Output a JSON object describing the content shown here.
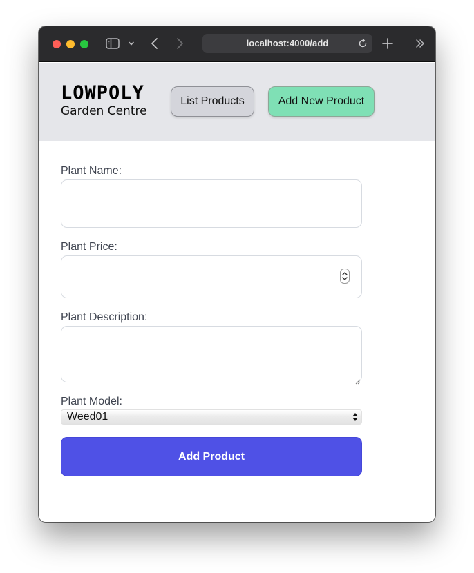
{
  "browser": {
    "url": "localhost:4000/add"
  },
  "header": {
    "logo_main": "LOWPOLY",
    "logo_sub": "Garden Centre",
    "nav": {
      "list_label": "List Products",
      "add_label": "Add New Product"
    },
    "colors": {
      "header_bg": "#e5e6ea",
      "list_button_bg": "#d4d5db",
      "add_button_bg": "#7fe0b5"
    }
  },
  "form": {
    "name_label": "Plant Name:",
    "name_value": "",
    "price_label": "Plant Price:",
    "price_value": "",
    "description_label": "Plant Description:",
    "description_value": "",
    "model_label": "Plant Model:",
    "model_selected": "Weed01",
    "submit_label": "Add Product",
    "colors": {
      "submit_bg": "#4f51e6"
    }
  }
}
